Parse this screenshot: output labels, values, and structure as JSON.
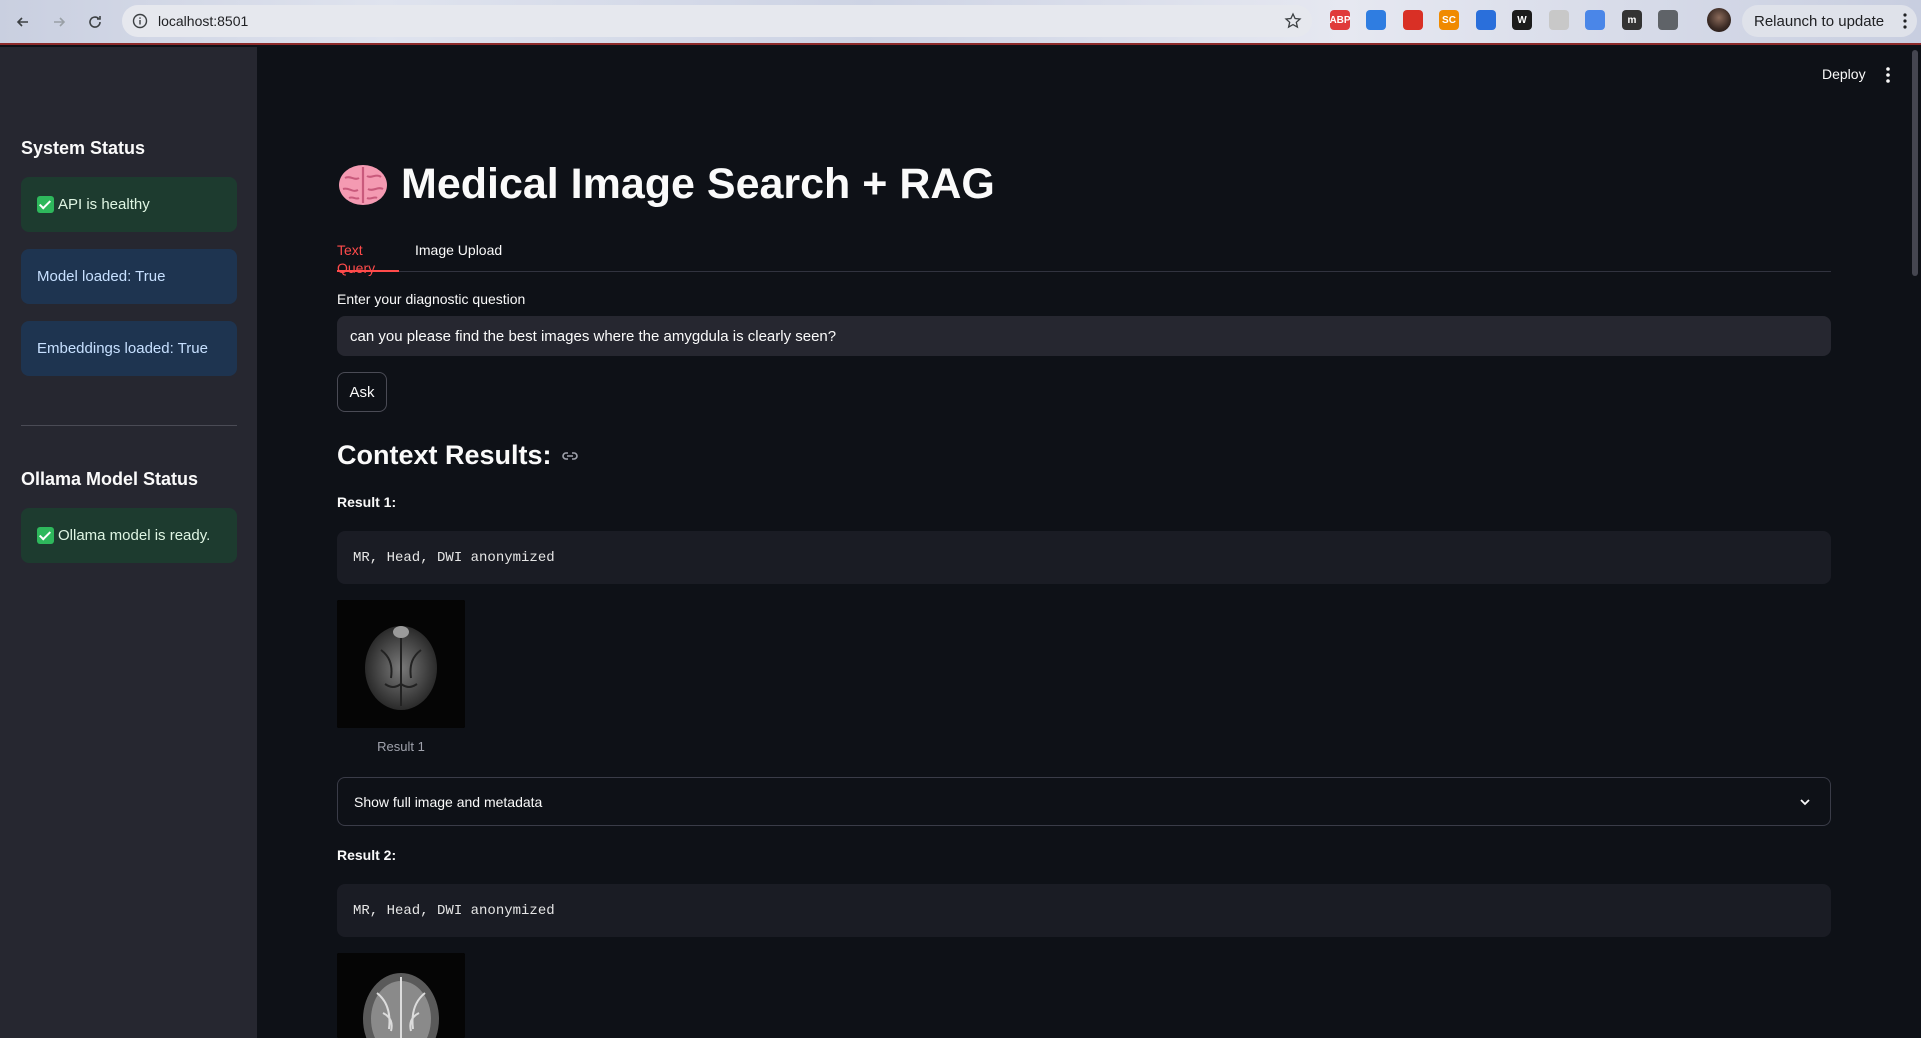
{
  "browser": {
    "url": "localhost:8501",
    "relaunch_label": "Relaunch to update",
    "extensions": [
      {
        "icon": "adblock-icon",
        "text": "ABP",
        "color": "#e03a3a"
      },
      {
        "icon": "sync-icon",
        "text": "",
        "color": "#2f7de1"
      },
      {
        "icon": "bookmark-red-icon",
        "text": "",
        "color": "#d93025"
      },
      {
        "icon": "sc-icon",
        "text": "SC",
        "color": "#f08a00"
      },
      {
        "icon": "diamond-icon",
        "text": "",
        "color": "#2a6fdb"
      },
      {
        "icon": "w-icon",
        "text": "W",
        "color": "#1c1c1c"
      },
      {
        "icon": "page-icon",
        "text": "",
        "color": "#c8c8c8"
      },
      {
        "icon": "translate-icon",
        "text": "",
        "color": "#4a86e8"
      },
      {
        "icon": "m-icon",
        "text": "m",
        "color": "#333333"
      },
      {
        "icon": "puzzle-icon",
        "text": "",
        "color": "#5f6368"
      }
    ]
  },
  "header": {
    "deploy_label": "Deploy"
  },
  "sidebar": {
    "system_status_heading": "System Status",
    "api_status": "API is healthy",
    "model_loaded": "Model loaded: True",
    "embeddings_loaded": "Embeddings loaded: True",
    "ollama_heading": "Ollama Model Status",
    "ollama_status": "Ollama model is ready."
  },
  "main": {
    "title": "Medical Image Search + RAG",
    "tabs": [
      {
        "label": "Text Query",
        "active": true
      },
      {
        "label": "Image Upload",
        "active": false
      }
    ],
    "question_label": "Enter your diagnostic question",
    "question_value": "can you please find the best images where the amygdula is clearly seen?",
    "ask_label": "Ask",
    "context_heading": "Context Results:",
    "results": [
      {
        "label": "Result 1:",
        "metadata": "MR, Head, DWI anonymized",
        "caption": "Result 1",
        "expander": "Show full image and metadata"
      },
      {
        "label": "Result 2:",
        "metadata": "MR, Head, DWI anonymized"
      }
    ]
  },
  "colors": {
    "background": "#0e1117",
    "sidebar": "#262730",
    "accent": "#ff4b4b",
    "success_bg": "#1d3b2f",
    "info_bg": "#1e3450"
  }
}
